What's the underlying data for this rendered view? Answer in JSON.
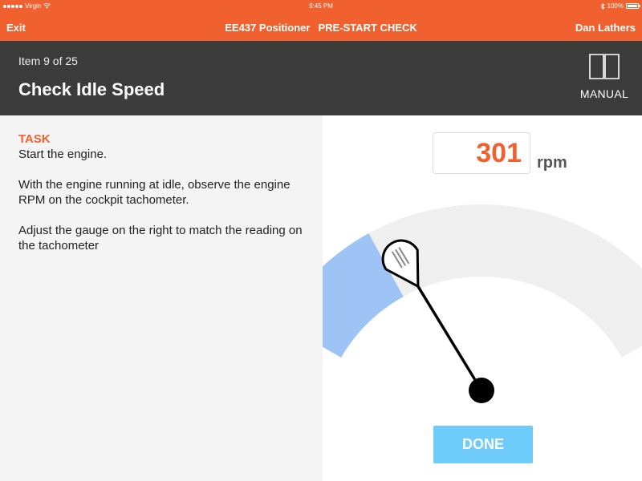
{
  "status_bar": {
    "carrier": "Virgin",
    "time": "9:45 PM",
    "battery": "100%"
  },
  "nav": {
    "exit_label": "Exit",
    "app_title": "EE437 Positioner",
    "mode": "PRE-START CHECK",
    "user": "Dan Lathers"
  },
  "header": {
    "item_count": "Item 9 of 25",
    "title": "Check Idle Speed",
    "manual_label": "MANUAL"
  },
  "task": {
    "label": "TASK",
    "steps": [
      "Start the engine.",
      "With the engine running at idle, observe the engine RPM on the cockpit tachometer.",
      "Adjust the gauge on the right to match the reading on the tachometer"
    ]
  },
  "gauge": {
    "value": "301",
    "unit": "rpm",
    "fill_fraction": 0.26,
    "fill_color": "#9ec3f5",
    "track_color": "#efefef",
    "needle_color": "#000000"
  },
  "done_label": "DONE",
  "colors": {
    "accent": "#f0612f",
    "header_bg": "#3c3c3c",
    "done_bg": "#6ecbfa"
  },
  "icons": {
    "manual": "book-icon",
    "wifi": "wifi-icon",
    "bluetooth": "bluetooth-icon",
    "battery": "battery-icon"
  }
}
